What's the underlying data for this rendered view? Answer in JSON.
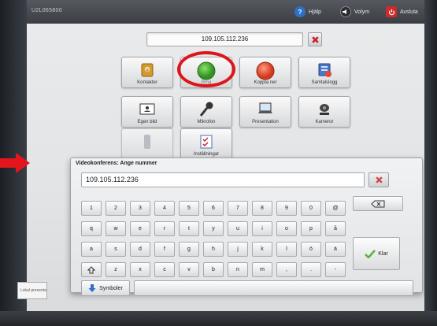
{
  "topbar": {
    "device_id": "U2L065800",
    "help_label": "Hjälp",
    "volume_label": "Volym",
    "exit_label": "Avsluta"
  },
  "address_field": {
    "value": "109.105.112.236"
  },
  "tiles": [
    {
      "label": "Kontakter",
      "icon": "address-book-icon"
    },
    {
      "label": "Ring",
      "icon": "green-call-icon"
    },
    {
      "label": "Koppla ner",
      "icon": "red-hangup-icon"
    },
    {
      "label": "Samtalslogg",
      "icon": "call-log-icon"
    },
    {
      "label": "Egen bild",
      "icon": "self-view-icon"
    },
    {
      "label": "Mikrofon",
      "icon": "microphone-icon"
    },
    {
      "label": "Presentation",
      "icon": "laptop-icon"
    },
    {
      "label": "Kameror",
      "icon": "camera-icon"
    },
    {
      "label": "Inställningar",
      "icon": "settings-checklist-icon"
    }
  ],
  "dialog": {
    "title": "Videokonferens: Ange nummer",
    "input_value": "109.105.112.236",
    "enter_label": "Klar",
    "symbols_label": "Symboler"
  },
  "keyboard": {
    "row1": [
      "1",
      "2",
      "3",
      "4",
      "5",
      "6",
      "7",
      "8",
      "9",
      "0",
      "@"
    ],
    "row2": [
      "q",
      "w",
      "e",
      "r",
      "t",
      "y",
      "u",
      "i",
      "o",
      "p",
      "å"
    ],
    "row3": [
      "a",
      "s",
      "d",
      "f",
      "g",
      "h",
      "j",
      "k",
      "l",
      "ö",
      "ä"
    ],
    "row4": [
      "z",
      "x",
      "c",
      "v",
      "b",
      "n",
      "m",
      ",",
      ".",
      "-"
    ]
  },
  "status": {
    "text": "Lokal presentation"
  },
  "colors": {
    "annotation_red": "#e0141b",
    "call_green": "#3ca62b",
    "hangup_red": "#e0452a",
    "enter_check": "#5bb230",
    "topbar": "#45494e"
  }
}
